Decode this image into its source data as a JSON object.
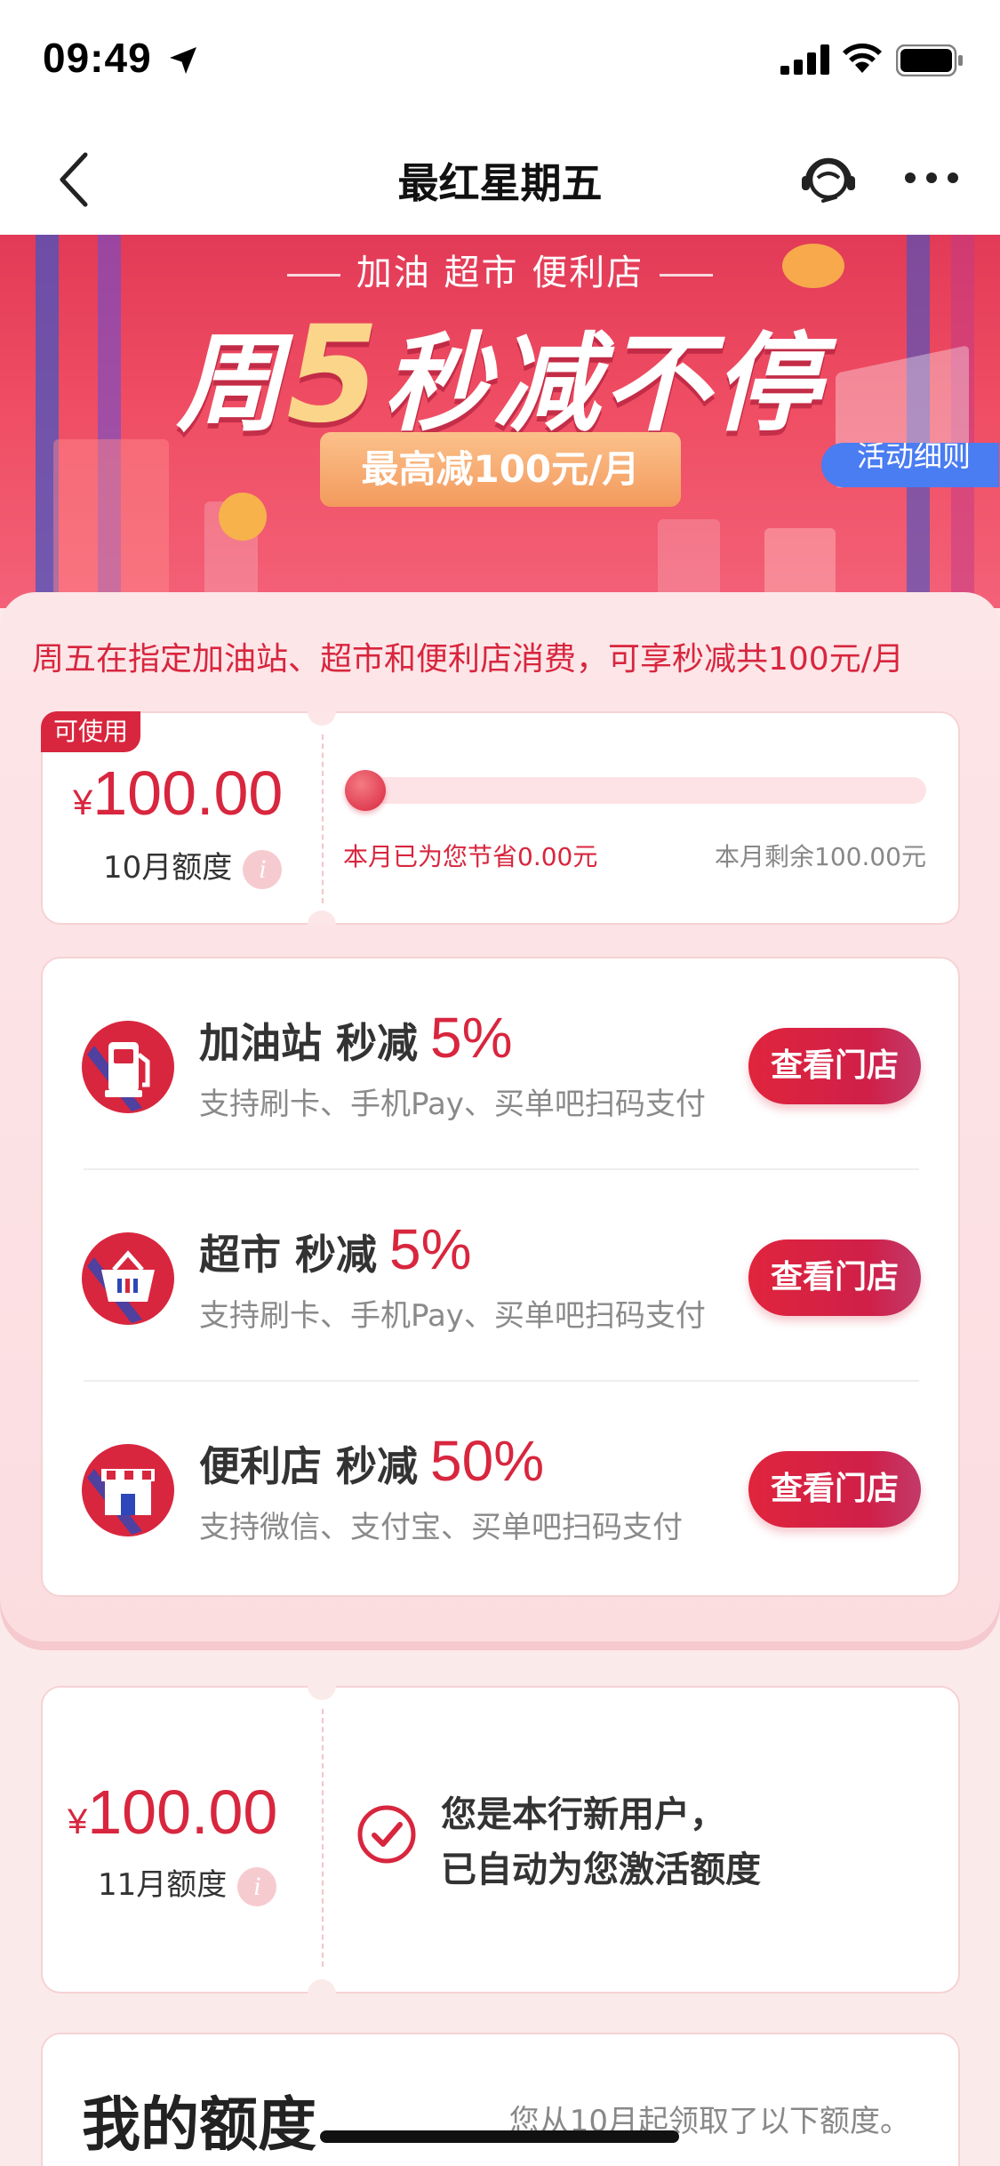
{
  "status_bar": {
    "time": "09:49"
  },
  "nav": {
    "title": "最红星期五"
  },
  "banner": {
    "top_text": "加油 超市 便利店",
    "main_pre": "周",
    "main_num": "5",
    "main_post": "秒减不停",
    "pill": "最高减100元/月",
    "rules_button": "活动细则"
  },
  "promo": {
    "text": "周五在指定加油站、超市和便利店消费，可享秒减共100元/月"
  },
  "quota": {
    "badge": "可使用",
    "currency": "¥",
    "amount": "100.00",
    "label": "10月额度",
    "info_glyph": "i",
    "progress": 0,
    "saved": "本月已为您节省0.00元",
    "remaining": "本月剩余100.00元"
  },
  "stores": [
    {
      "name": "加油站 秒减",
      "pct": "5%",
      "desc": "支持刷卡、手机Pay、买单吧扫码支付",
      "button": "查看门店",
      "icon": "gas-station-icon"
    },
    {
      "name": "超市 秒减",
      "pct": "5%",
      "desc": "支持刷卡、手机Pay、买单吧扫码支付",
      "button": "查看门店",
      "icon": "shopping-basket-icon"
    },
    {
      "name": "便利店 秒减",
      "pct": "50%",
      "desc": "支持微信、支付宝、买单吧扫码支付",
      "button": "查看门店",
      "icon": "store-icon"
    }
  ],
  "november": {
    "currency": "¥",
    "amount": "100.00",
    "label": "11月额度",
    "info_glyph": "i",
    "line1": "您是本行新用户，",
    "line2": "已自动为您激活额度"
  },
  "my_quota": {
    "title": "我的额度",
    "note": "您从10月起领取了以下额度。"
  },
  "colors": {
    "accent": "#d8263e",
    "background": "#fbeaea",
    "rules_blue": "#4a7cf2"
  }
}
